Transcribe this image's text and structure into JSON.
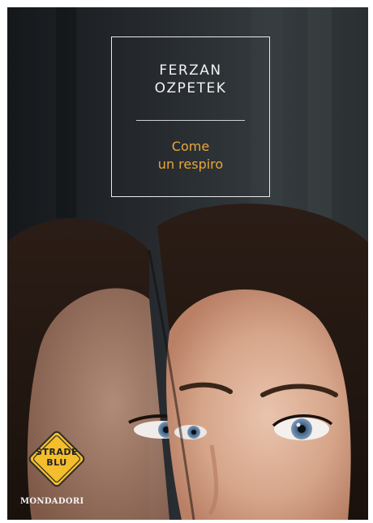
{
  "cover": {
    "author_line1": "FERZAN",
    "author_line2": "OZPETEK",
    "title_line1": "Come",
    "title_line2": "un respiro",
    "badge_line1": "STRADE",
    "badge_line2": "BLU",
    "publisher": "MONDADORI"
  },
  "colors": {
    "title_accent": "#e9a83a",
    "badge_fill": "#f3bd2c",
    "background_dark": "#1e2124"
  },
  "icons": {
    "badge_shape": "diamond-road-sign"
  }
}
